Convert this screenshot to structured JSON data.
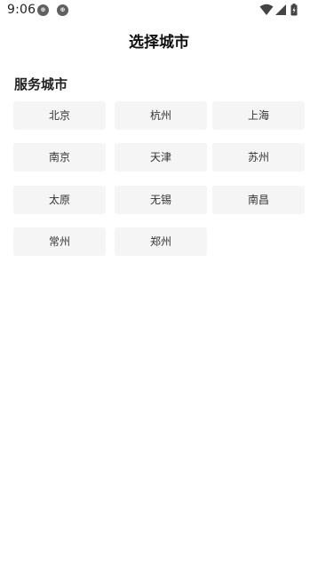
{
  "status_bar": {
    "time": "9:06",
    "notification_icons": [
      "app-notification-icon",
      "app-notification-icon"
    ],
    "icons": [
      "wifi-icon",
      "cellular-signal-icon",
      "battery-icon"
    ]
  },
  "header": {
    "title": "选择城市"
  },
  "section": {
    "title": "服务城市"
  },
  "cities": [
    "北京",
    "杭州",
    "上海",
    "南京",
    "天津",
    "苏州",
    "太原",
    "无锡",
    "南昌",
    "常州",
    "郑州"
  ]
}
